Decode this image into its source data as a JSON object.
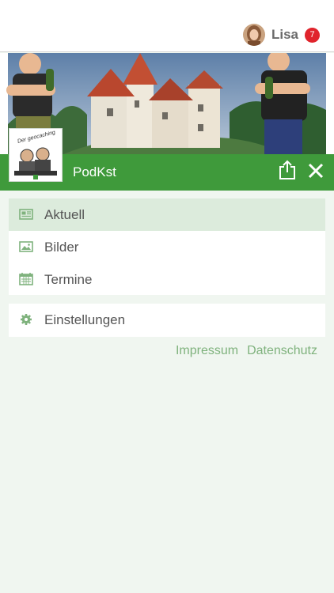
{
  "user": {
    "name": "Lisa",
    "notification_count": "7"
  },
  "header": {
    "app_title": "PodKst"
  },
  "logo": {
    "text": "Der geocaching"
  },
  "menu": {
    "items": [
      {
        "label": "Aktuell",
        "icon": "newspaper-icon",
        "active": true
      },
      {
        "label": "Bilder",
        "icon": "image-icon",
        "active": false
      },
      {
        "label": "Termine",
        "icon": "calendar-icon",
        "active": false
      }
    ],
    "settings_label": "Einstellungen"
  },
  "footer": {
    "impressum": "Impressum",
    "datenschutz": "Datenschutz"
  },
  "colors": {
    "brand_green": "#3f9a3b",
    "background": "#f0f6f0",
    "active_item": "#dcebdc",
    "link_green": "#7fb27d",
    "badge_red": "#e0242c"
  }
}
